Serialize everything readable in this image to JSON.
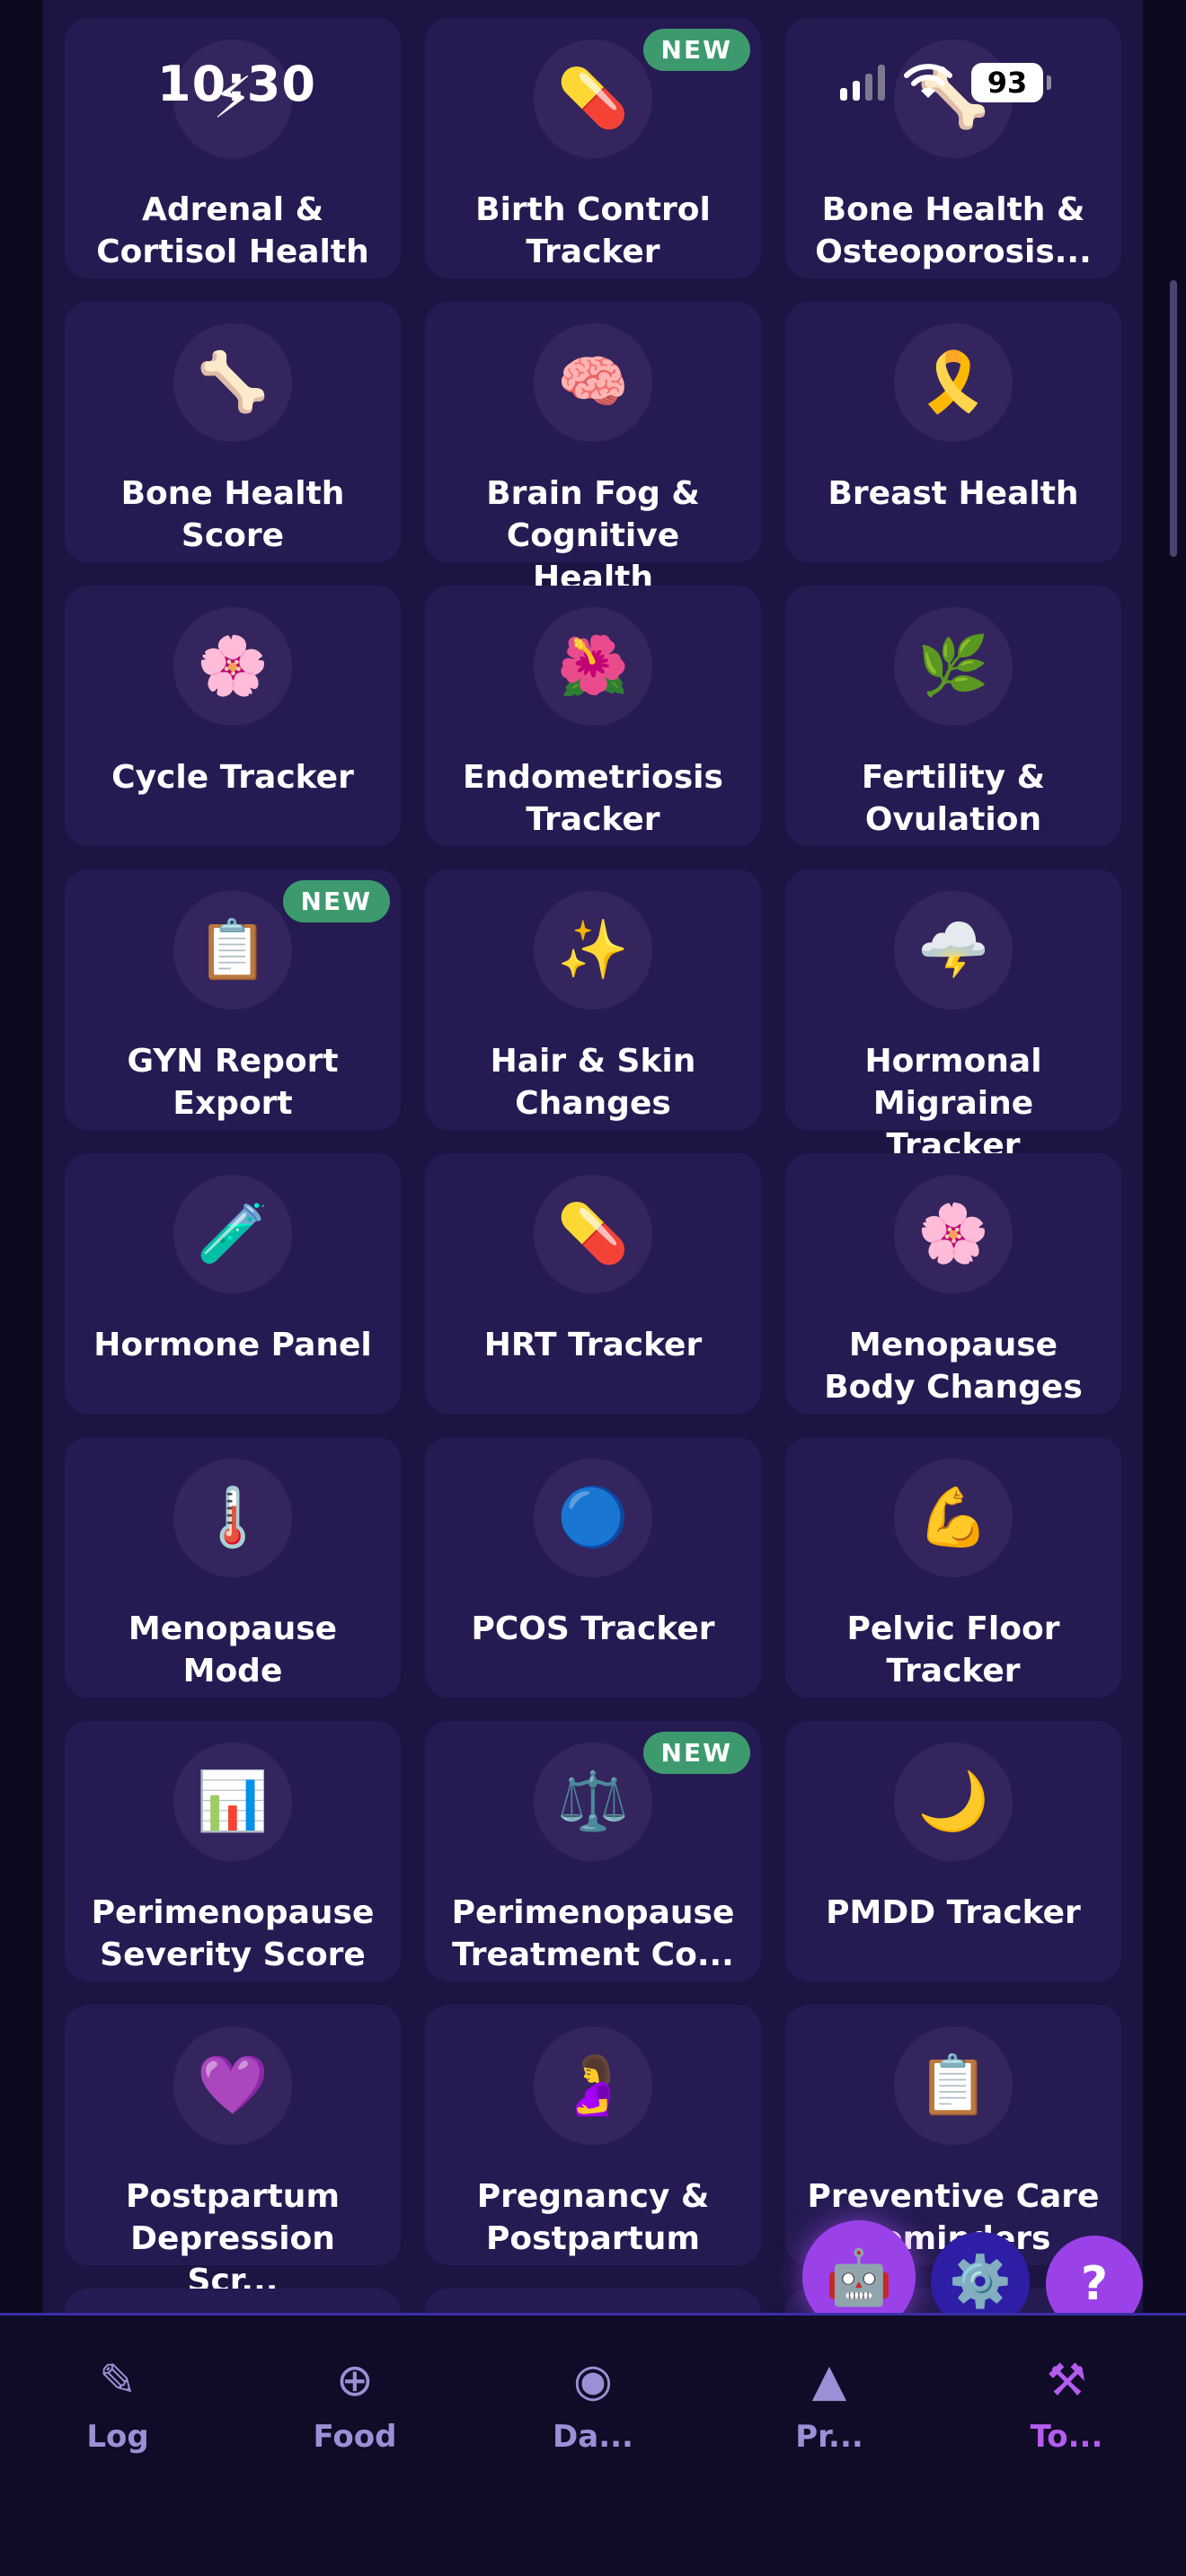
{
  "status_bar": {
    "time": "10:30",
    "battery": "93"
  },
  "cards": [
    {
      "title": "Adrenal & Cortisol Health",
      "icon": "lightning-icon",
      "glyph": "⚡",
      "badge": ""
    },
    {
      "title": "Birth Control Tracker",
      "icon": "pill-icon",
      "glyph": "💊",
      "badge": "NEW"
    },
    {
      "title": "Bone Health & Osteoporosis...",
      "icon": "bone-icon",
      "glyph": "🦴",
      "badge": ""
    },
    {
      "title": "Bone Health Score",
      "icon": "bone-icon",
      "glyph": "🦴",
      "badge": ""
    },
    {
      "title": "Brain Fog & Cognitive Health",
      "icon": "brain-icon",
      "glyph": "🧠",
      "badge": ""
    },
    {
      "title": "Breast Health",
      "icon": "ribbon-icon",
      "glyph": "🎗️",
      "badge": ""
    },
    {
      "title": "Cycle Tracker",
      "icon": "cherry-blossom-icon",
      "glyph": "🌸",
      "badge": ""
    },
    {
      "title": "Endometriosis Tracker",
      "icon": "hibiscus-icon",
      "glyph": "🌺",
      "badge": ""
    },
    {
      "title": "Fertility & Ovulation",
      "icon": "herb-icon",
      "glyph": "🌿",
      "badge": ""
    },
    {
      "title": "GYN Report Export",
      "icon": "clipboard-icon",
      "glyph": "📋",
      "badge": "NEW"
    },
    {
      "title": "Hair & Skin Changes",
      "icon": "sparkles-icon",
      "glyph": "✨",
      "badge": ""
    },
    {
      "title": "Hormonal Migraine Tracker",
      "icon": "storm-cloud-icon",
      "glyph": "🌩️",
      "badge": ""
    },
    {
      "title": "Hormone Panel",
      "icon": "test-tube-icon",
      "glyph": "🧪",
      "badge": ""
    },
    {
      "title": "HRT Tracker",
      "icon": "pill-icon",
      "glyph": "💊",
      "badge": ""
    },
    {
      "title": "Menopause Body Changes",
      "icon": "cherry-blossom-icon",
      "glyph": "🌸",
      "badge": ""
    },
    {
      "title": "Menopause Mode",
      "icon": "thermometer-icon",
      "glyph": "🌡️",
      "badge": ""
    },
    {
      "title": "PCOS Tracker",
      "icon": "blue-circle-icon",
      "glyph": "🔵",
      "badge": ""
    },
    {
      "title": "Pelvic Floor Tracker",
      "icon": "flexed-biceps-icon",
      "glyph": "💪",
      "badge": ""
    },
    {
      "title": "Perimenopause Severity Score",
      "icon": "bar-chart-icon",
      "glyph": "📊",
      "badge": ""
    },
    {
      "title": "Perimenopause Treatment Co...",
      "icon": "balance-scale-icon",
      "glyph": "⚖️",
      "badge": "NEW"
    },
    {
      "title": "PMDD Tracker",
      "icon": "crescent-moon-icon",
      "glyph": "🌙",
      "badge": ""
    },
    {
      "title": "Postpartum Depression Scr...",
      "icon": "purple-heart-icon",
      "glyph": "💜",
      "badge": ""
    },
    {
      "title": "Pregnancy & Postpartum",
      "icon": "pregnant-woman-icon",
      "glyph": "🤰",
      "badge": ""
    },
    {
      "title": "Preventive Care Reminders",
      "icon": "clipboard-icon",
      "glyph": "📋",
      "badge": ""
    },
    {
      "title": "",
      "icon": "",
      "glyph": "",
      "badge": ""
    },
    {
      "title": "",
      "icon": "",
      "glyph": "",
      "badge": ""
    },
    {
      "title": "",
      "icon": "",
      "glyph": "",
      "badge": ""
    }
  ],
  "fabs": {
    "assistant_glyph": "🤖",
    "settings_glyph": "⚙️",
    "help_label": "?"
  },
  "tabbar": {
    "log": {
      "label": "Log",
      "glyph": "✎",
      "icon": "pencil-icon"
    },
    "food": {
      "label": "Food",
      "glyph": "⊕",
      "icon": "plus-circle-icon"
    },
    "da": {
      "label": "Da...",
      "glyph": "◉",
      "icon": "record-circle-icon"
    },
    "pr": {
      "label": "Pr...",
      "glyph": "▲",
      "icon": "triangle-icon"
    },
    "to": {
      "label": "To...",
      "glyph": "⚒",
      "icon": "hammer-pick-icon",
      "active": true
    }
  },
  "colors": {
    "background": "#1c1442",
    "card": "#251b52",
    "badge": "#3d9a6e",
    "accent": "#b55cf0",
    "tab_inactive": "#9d8fd6"
  }
}
